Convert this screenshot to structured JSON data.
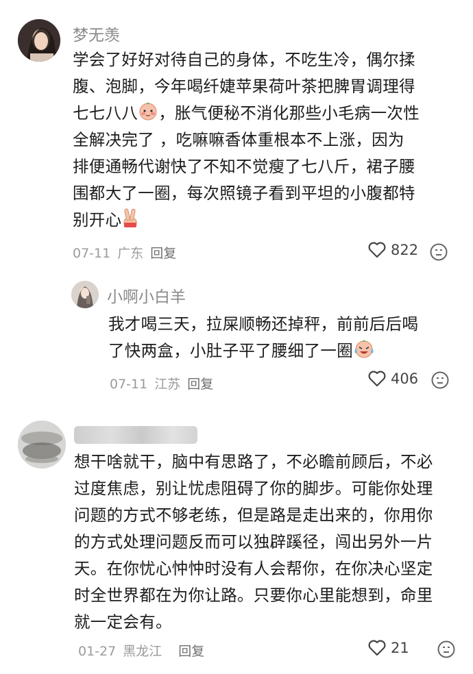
{
  "comments": [
    {
      "username": "梦无羡",
      "text_lines": [
        "学会了好好对待自己的身体，不吃生冷，偶尔揉",
        "腹、泡脚，今年喝纤婕苹果荷叶茶把脾胃调理得",
        "七七八八",
        "，胀气便秘不消化那些小毛病一次性",
        "全解决完了    ，吃嘛嘛香体重根本不上涨，因为",
        "排便通畅代谢快了不知不觉瘦了七八斤，裙子腰",
        "围都大了一圈，每次照镜子看到平坦的小腹都特",
        "别开心"
      ],
      "date": "07-11",
      "location": "广东",
      "reply_label": "回复",
      "likes": "822"
    },
    {
      "username": "小啊小白羊",
      "text_lines": [
        "我才喝三天，拉屎顺畅还掉秤，前前后后喝",
        "了快两盒，小肚子平了腰细了一圈"
      ],
      "date": "07-11",
      "location": "江苏",
      "reply_label": "回复",
      "likes": "406"
    },
    {
      "username": "",
      "text_lines": [
        "想干啥就干，脑中有思路了，不必瞻前顾后，不必",
        "过度焦虑，别让忧虑阻碍了你的脚步。可能你处理",
        "问题的方式不够老练，但是路是走出来的，你用你",
        "的方式处理问题反而可以独辟蹊径，闯出另外一片",
        "天。在你忧心忡忡时没有人会帮你，在你决心坚定",
        "时全世界都在为你让路。只要你心里能想到，命里",
        "就一定会有。"
      ],
      "date": "01-27",
      "location": "黑龙江",
      "reply_label": "回复",
      "likes": "21"
    }
  ]
}
